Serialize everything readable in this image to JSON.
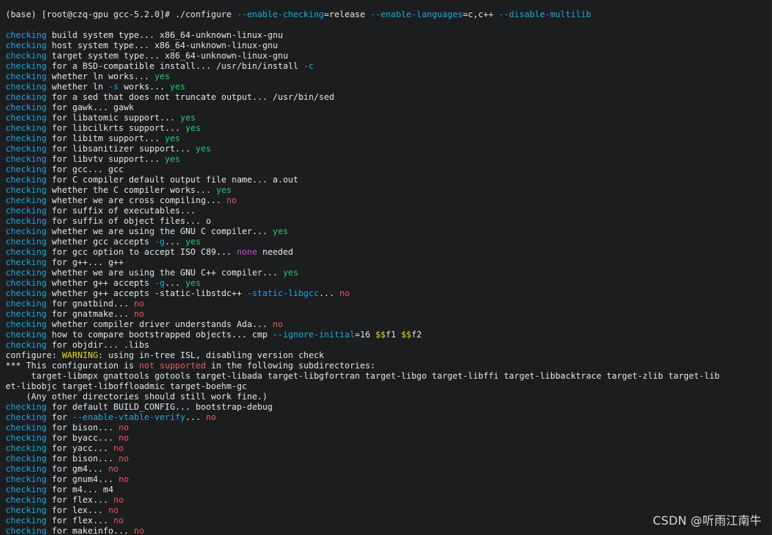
{
  "colors": {
    "background": "#1b1d1f",
    "default": "#e6e6e6",
    "blue": "#1ea8dc",
    "green": "#25cc6c",
    "red": "#f0575a",
    "magenta": "#d44ad6",
    "yellow": "#e6d91b"
  },
  "watermark": "CSDN @听雨江南牛",
  "lines": [
    {
      "name": "command-prompt-line",
      "segs": [
        [
          "w",
          "(base) [root@czq-gpu gcc-5.2.0]# ./configure "
        ],
        [
          "b",
          "--enable-checking"
        ],
        [
          "w",
          "=release "
        ],
        [
          "b",
          "--enable-languages"
        ],
        [
          "w",
          "=c,c++ "
        ],
        [
          "b",
          "--disable-multilib"
        ]
      ]
    },
    {
      "blank": true
    },
    {
      "segs": [
        [
          "b",
          "checking"
        ],
        [
          "w",
          " build system type... x86_64-unknown-linux-gnu"
        ]
      ]
    },
    {
      "segs": [
        [
          "b",
          "checking"
        ],
        [
          "w",
          " host system type... x86_64-unknown-linux-gnu"
        ]
      ]
    },
    {
      "segs": [
        [
          "b",
          "checking"
        ],
        [
          "w",
          " target system type... x86_64-unknown-linux-gnu"
        ]
      ]
    },
    {
      "segs": [
        [
          "b",
          "checking"
        ],
        [
          "w",
          " for a BSD-compatible install... /usr/bin/install "
        ],
        [
          "b",
          "-c"
        ]
      ]
    },
    {
      "segs": [
        [
          "b",
          "checking"
        ],
        [
          "w",
          " whether ln works... "
        ],
        [
          "g",
          "yes"
        ]
      ]
    },
    {
      "segs": [
        [
          "b",
          "checking"
        ],
        [
          "w",
          " whether ln "
        ],
        [
          "b",
          "-s"
        ],
        [
          "w",
          " works... "
        ],
        [
          "g",
          "yes"
        ]
      ]
    },
    {
      "segs": [
        [
          "b",
          "checking"
        ],
        [
          "w",
          " for a sed that does not truncate output... /usr/bin/sed"
        ]
      ]
    },
    {
      "segs": [
        [
          "b",
          "checking"
        ],
        [
          "w",
          " for gawk... gawk"
        ]
      ]
    },
    {
      "segs": [
        [
          "b",
          "checking"
        ],
        [
          "w",
          " for libatomic support... "
        ],
        [
          "g",
          "yes"
        ]
      ]
    },
    {
      "segs": [
        [
          "b",
          "checking"
        ],
        [
          "w",
          " for libcilkrts support... "
        ],
        [
          "g",
          "yes"
        ]
      ]
    },
    {
      "segs": [
        [
          "b",
          "checking"
        ],
        [
          "w",
          " for libitm support... "
        ],
        [
          "g",
          "yes"
        ]
      ]
    },
    {
      "segs": [
        [
          "b",
          "checking"
        ],
        [
          "w",
          " for libsanitizer support... "
        ],
        [
          "g",
          "yes"
        ]
      ]
    },
    {
      "segs": [
        [
          "b",
          "checking"
        ],
        [
          "w",
          " for libvtv support... "
        ],
        [
          "g",
          "yes"
        ]
      ]
    },
    {
      "segs": [
        [
          "b",
          "checking"
        ],
        [
          "w",
          " for gcc... gcc"
        ]
      ]
    },
    {
      "segs": [
        [
          "b",
          "checking"
        ],
        [
          "w",
          " for C compiler default output file name... a.out"
        ]
      ]
    },
    {
      "segs": [
        [
          "b",
          "checking"
        ],
        [
          "w",
          " whether the C compiler works... "
        ],
        [
          "g",
          "yes"
        ]
      ]
    },
    {
      "segs": [
        [
          "b",
          "checking"
        ],
        [
          "w",
          " whether we are cross compiling... "
        ],
        [
          "r",
          "no"
        ]
      ]
    },
    {
      "segs": [
        [
          "b",
          "checking"
        ],
        [
          "w",
          " for suffix of executables..."
        ]
      ]
    },
    {
      "segs": [
        [
          "b",
          "checking"
        ],
        [
          "w",
          " for suffix of object files... o"
        ]
      ]
    },
    {
      "segs": [
        [
          "b",
          "checking"
        ],
        [
          "w",
          " whether we are using the GNU C compiler... "
        ],
        [
          "g",
          "yes"
        ]
      ]
    },
    {
      "segs": [
        [
          "b",
          "checking"
        ],
        [
          "w",
          " whether gcc accepts "
        ],
        [
          "b",
          "-g"
        ],
        [
          "w",
          "... "
        ],
        [
          "g",
          "yes"
        ]
      ]
    },
    {
      "segs": [
        [
          "b",
          "checking"
        ],
        [
          "w",
          " for gcc option to accept ISO C89... "
        ],
        [
          "m",
          "none"
        ],
        [
          "w",
          " needed"
        ]
      ]
    },
    {
      "segs": [
        [
          "b",
          "checking"
        ],
        [
          "w",
          " for g++... g++"
        ]
      ]
    },
    {
      "segs": [
        [
          "b",
          "checking"
        ],
        [
          "w",
          " whether we are using the GNU C++ compiler... "
        ],
        [
          "g",
          "yes"
        ]
      ]
    },
    {
      "segs": [
        [
          "b",
          "checking"
        ],
        [
          "w",
          " whether g++ accepts "
        ],
        [
          "b",
          "-g"
        ],
        [
          "w",
          "... "
        ],
        [
          "g",
          "yes"
        ]
      ]
    },
    {
      "segs": [
        [
          "b",
          "checking"
        ],
        [
          "w",
          " whether g++ accepts -static-libstdc++ "
        ],
        [
          "b",
          "-static-libgcc"
        ],
        [
          "w",
          "... "
        ],
        [
          "r",
          "no"
        ]
      ]
    },
    {
      "segs": [
        [
          "b",
          "checking"
        ],
        [
          "w",
          " for gnatbind... "
        ],
        [
          "r",
          "no"
        ]
      ]
    },
    {
      "segs": [
        [
          "b",
          "checking"
        ],
        [
          "w",
          " for gnatmake... "
        ],
        [
          "r",
          "no"
        ]
      ]
    },
    {
      "segs": [
        [
          "b",
          "checking"
        ],
        [
          "w",
          " whether compiler driver understands Ada... "
        ],
        [
          "r",
          "no"
        ]
      ]
    },
    {
      "segs": [
        [
          "b",
          "checking"
        ],
        [
          "w",
          " how to compare bootstrapped objects... cmp "
        ],
        [
          "b",
          "--ignore-initial"
        ],
        [
          "w",
          "=16 "
        ],
        [
          "y",
          "$$"
        ],
        [
          "w",
          "f1 "
        ],
        [
          "y",
          "$$"
        ],
        [
          "w",
          "f2"
        ]
      ]
    },
    {
      "segs": [
        [
          "b",
          "checking"
        ],
        [
          "w",
          " for objdir... .libs"
        ]
      ]
    },
    {
      "segs": [
        [
          "w",
          "configure: "
        ],
        [
          "y",
          "WARNING"
        ],
        [
          "w",
          ": using in-tree ISL, disabling version check"
        ]
      ]
    },
    {
      "segs": [
        [
          "w",
          "*** This configuration is "
        ],
        [
          "r",
          "not supported"
        ],
        [
          "w",
          " in the following subdirectories:"
        ]
      ]
    },
    {
      "segs": [
        [
          "w",
          "     target-libmpx gnattools gotools target-libada target-libgfortran target-libgo target-libffi target-libbacktrace target-zlib target-lib"
        ]
      ]
    },
    {
      "segs": [
        [
          "w",
          "et-libobjc target-liboffloadmic target-boehm-gc"
        ]
      ]
    },
    {
      "segs": [
        [
          "w",
          "    (Any other directories should still work fine.)"
        ]
      ]
    },
    {
      "segs": [
        [
          "b",
          "checking"
        ],
        [
          "w",
          " for default BUILD_CONFIG... bootstrap-debug"
        ]
      ]
    },
    {
      "segs": [
        [
          "b",
          "checking"
        ],
        [
          "w",
          " for "
        ],
        [
          "b",
          "--enable-vtable-verify"
        ],
        [
          "w",
          "... "
        ],
        [
          "r",
          "no"
        ]
      ]
    },
    {
      "segs": [
        [
          "b",
          "checking"
        ],
        [
          "w",
          " for bison... "
        ],
        [
          "r",
          "no"
        ]
      ]
    },
    {
      "segs": [
        [
          "b",
          "checking"
        ],
        [
          "w",
          " for byacc... "
        ],
        [
          "r",
          "no"
        ]
      ]
    },
    {
      "segs": [
        [
          "b",
          "checking"
        ],
        [
          "w",
          " for yacc... "
        ],
        [
          "r",
          "no"
        ]
      ]
    },
    {
      "segs": [
        [
          "b",
          "checking"
        ],
        [
          "w",
          " for bison... "
        ],
        [
          "r",
          "no"
        ]
      ]
    },
    {
      "segs": [
        [
          "b",
          "checking"
        ],
        [
          "w",
          " for gm4... "
        ],
        [
          "r",
          "no"
        ]
      ]
    },
    {
      "segs": [
        [
          "b",
          "checking"
        ],
        [
          "w",
          " for gnum4... "
        ],
        [
          "r",
          "no"
        ]
      ]
    },
    {
      "segs": [
        [
          "b",
          "checking"
        ],
        [
          "w",
          " for m4... m4"
        ]
      ]
    },
    {
      "segs": [
        [
          "b",
          "checking"
        ],
        [
          "w",
          " for flex... "
        ],
        [
          "r",
          "no"
        ]
      ]
    },
    {
      "segs": [
        [
          "b",
          "checking"
        ],
        [
          "w",
          " for lex... "
        ],
        [
          "r",
          "no"
        ]
      ]
    },
    {
      "segs": [
        [
          "b",
          "checking"
        ],
        [
          "w",
          " for flex... "
        ],
        [
          "r",
          "no"
        ]
      ]
    },
    {
      "segs": [
        [
          "b",
          "checking"
        ],
        [
          "w",
          " for makeinfo... "
        ],
        [
          "r",
          "no"
        ]
      ]
    }
  ]
}
